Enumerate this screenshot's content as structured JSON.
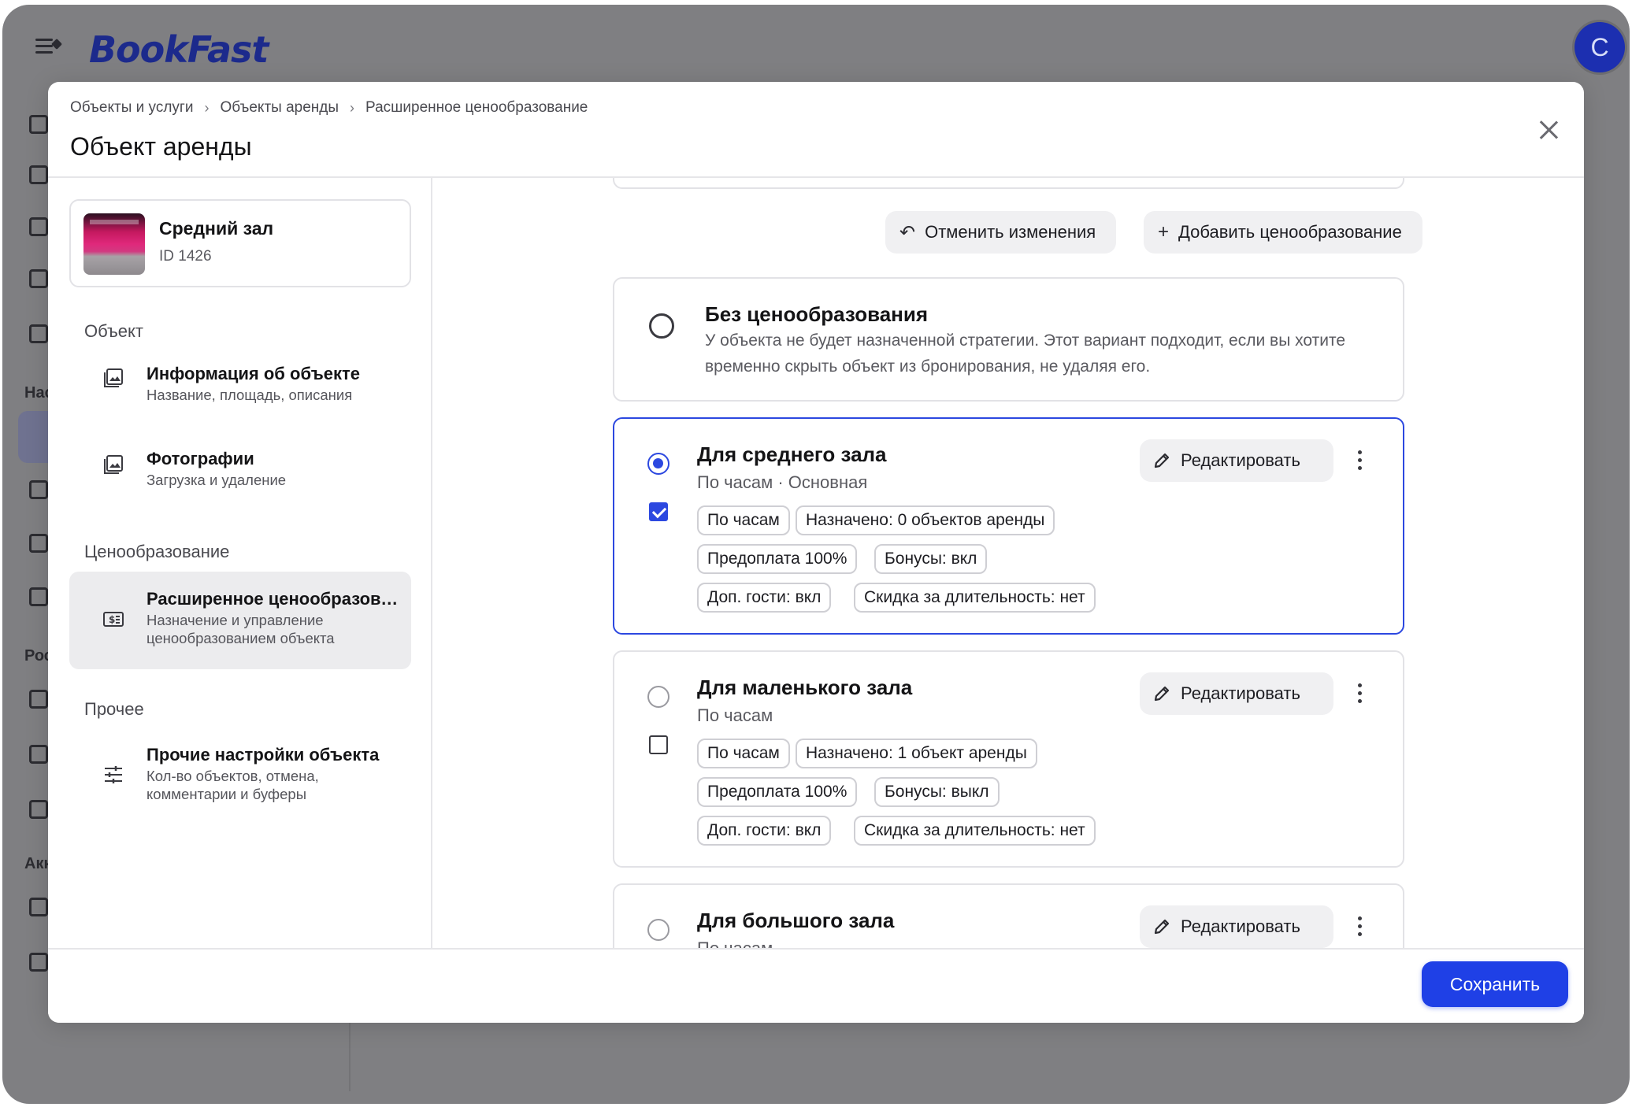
{
  "app": {
    "logo_text": "BookFast",
    "avatar_initial": "C",
    "rail_labels": [
      "Нас",
      "Рос",
      "Акк"
    ]
  },
  "modal": {
    "breadcrumb": [
      "Объекты и услуги",
      "Объекты аренды",
      "Расширенное ценообразование"
    ],
    "title": "Объект аренды"
  },
  "object": {
    "name": "Средний зал",
    "id_text": "ID 1426"
  },
  "sidebar": {
    "sections": [
      {
        "label": "Объект",
        "items": [
          {
            "title": "Информация об объекте",
            "subtitle": "Название, площадь, описания"
          },
          {
            "title": "Фотографии",
            "subtitle": "Загрузка и удаление"
          }
        ]
      },
      {
        "label": "Ценообразование",
        "items": [
          {
            "title": "Расширенное ценообразование",
            "subtitle": "Назначение и управление ценообразованием объекта"
          }
        ]
      },
      {
        "label": "Прочее",
        "items": [
          {
            "title": "Прочие настройки объекта",
            "subtitle": "Кол-во объектов, отмена, комментарии и буферы"
          }
        ]
      }
    ]
  },
  "actions": {
    "cancel_changes": "Отменить изменения",
    "add_pricing": "Добавить ценообразование"
  },
  "strategies": [
    {
      "title": "Без ценообразования",
      "description": "У объекта не будет назначенной стратегии. Этот вариант подходит, если вы хотите временно скрыть объект из бронирования, не удаляя его."
    },
    {
      "title": "Для среднего зала",
      "subtitle": "По часам · Основная",
      "edit_label": "Редактировать",
      "selected": true,
      "checked": true,
      "tags": [
        "По часам",
        "Назначено: 0 объектов аренды",
        "Предоплата 100%",
        "Бонусы: вкл",
        "Доп. гости: вкл",
        "Скидка за длительность: нет"
      ]
    },
    {
      "title": "Для маленького зала",
      "subtitle": "По часам",
      "edit_label": "Редактировать",
      "selected": false,
      "checked": false,
      "tags": [
        "По часам",
        "Назначено: 1 объект аренды",
        "Предоплата 100%",
        "Бонусы: выкл",
        "Доп. гости: вкл",
        "Скидка за длительность: нет"
      ]
    },
    {
      "title": "Для большого зала",
      "subtitle": "По часам",
      "edit_label": "Редактировать",
      "selected": false
    }
  ],
  "footer": {
    "save_label": "Сохранить"
  },
  "colors": {
    "accent": "#1f40e6",
    "brand": "#1c2a8c",
    "overlay": "#7f7f82"
  }
}
